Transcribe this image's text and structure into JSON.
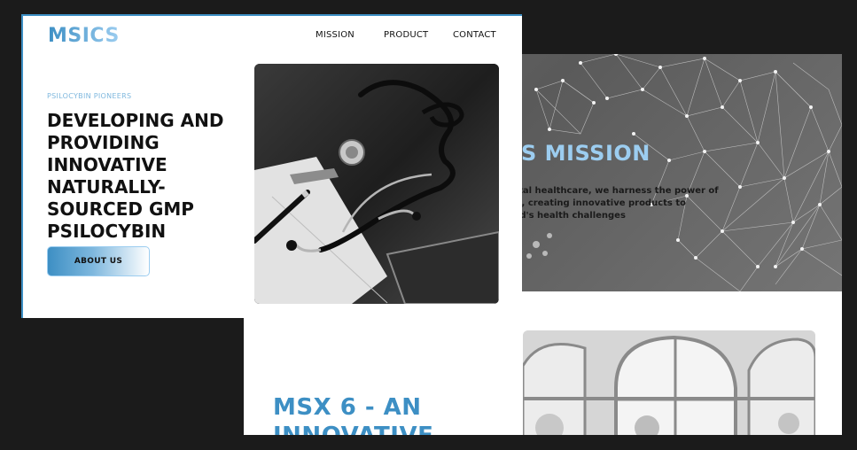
{
  "front_page": {
    "logo": "MSICS",
    "nav": {
      "mission": "MISSION",
      "product": "PRODUCT",
      "contact": "CONTACT"
    },
    "eyebrow": "PSILOCYBIN PIONEERS",
    "hero_title_lines": [
      "DEVELOPING AND",
      "PROVIDING",
      "INNOVATIVE",
      "NATURALLY-",
      "SOURCED GMP",
      "PSILOCYBIN"
    ],
    "about_button": "ABOUT US",
    "hero_image": "stethoscope-photo"
  },
  "back_page": {
    "mission_title": "S MISSION",
    "mission_text_lines": [
      "ntal healthcare, we harness the power of",
      "in, creating innovative products to",
      "rld's health challenges"
    ],
    "msx_title_lines": [
      "MSX 6 - AN",
      "INNOVATIVE"
    ],
    "arch_image": "arched-windows-photo"
  },
  "colors": {
    "accent": "#3d8fc4",
    "accent_light": "#9ccdf0",
    "background": "#1b1b1b"
  }
}
